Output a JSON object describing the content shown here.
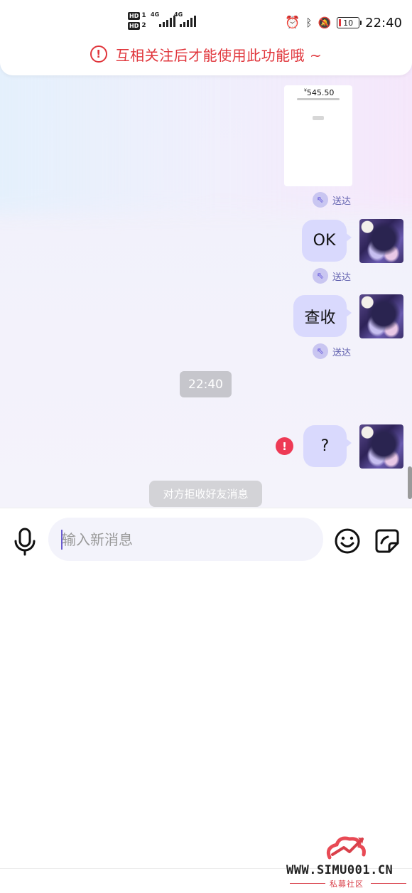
{
  "status_bar": {
    "sim1_tag": "HD",
    "sim1_num": "1",
    "sim2_tag": "HD",
    "sim2_num": "2",
    "net1": "4G",
    "net2": "4G",
    "battery": "10",
    "time": "22:40",
    "icons": [
      "alarm-icon",
      "bluetooth-icon",
      "vibrate-icon",
      "mute-bell-icon"
    ]
  },
  "banner": {
    "icon": "!",
    "text": "互相关注后才能使用此功能哦 ~"
  },
  "messages": {
    "image_msg": {
      "amount": "545.50",
      "currency": "¥"
    },
    "delivered_label": "送达",
    "ok_text": "OK",
    "check_text": "查收",
    "timestamp": "22:40",
    "question_text": "?",
    "error_icon": "!",
    "system_notice": "对方拒收好友消息"
  },
  "input": {
    "placeholder": "输入新消息"
  },
  "watermark": {
    "url": "WWW.SIMU001.CN",
    "sub": "私募社区"
  },
  "colors": {
    "accent_red": "#e0353b",
    "bubble": "#d9d9fd",
    "delivered_text": "#5f5fae",
    "error_red": "#ee3a55"
  }
}
